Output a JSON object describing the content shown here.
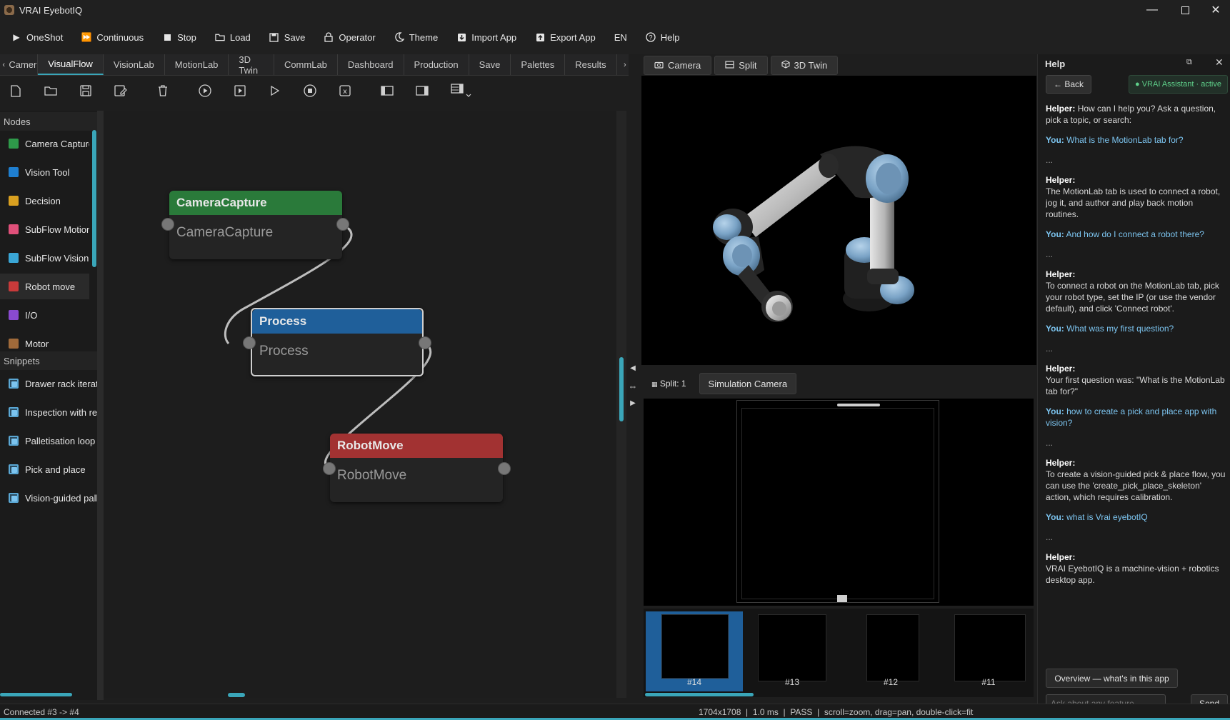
{
  "window": {
    "title": "VRAI EyebotIQ"
  },
  "toolbar": {
    "oneshot": "OneShot",
    "continuous": "Continuous",
    "stop": "Stop",
    "load": "Load",
    "save": "Save",
    "operator": "Operator",
    "theme": "Theme",
    "import_app": "Import App",
    "export_app": "Export App",
    "language": "EN",
    "help": "Help"
  },
  "tabs": [
    "Camera",
    "VisualFlow",
    "VisionLab",
    "MotionLab",
    "3D Twin",
    "CommLab",
    "Dashboard",
    "Production",
    "Save",
    "Palettes",
    "Results"
  ],
  "active_tab": "VisualFlow",
  "sidebar": {
    "nodes_header": "Nodes",
    "nodes": [
      {
        "label": "Camera Capture",
        "color": "#2e9a4a"
      },
      {
        "label": "Vision Tool",
        "color": "#1f7fd0"
      },
      {
        "label": "Decision",
        "color": "#d9a020"
      },
      {
        "label": "SubFlow Motion",
        "color": "#e0507a"
      },
      {
        "label": "SubFlow Vision",
        "color": "#3aa6d6"
      },
      {
        "label": "Robot move",
        "color": "#c83a3a"
      },
      {
        "label": "I/O",
        "color": "#8a4ad0"
      },
      {
        "label": "Motor",
        "color": "#a06a3a"
      }
    ],
    "snippets_header": "Snippets",
    "snippets": [
      "Drawer rack iteratio",
      "Inspection with retr",
      "Palletisation loop",
      "Pick and place",
      "Vision-guided palle"
    ]
  },
  "flow": {
    "nodes": [
      {
        "title": "CameraCapture",
        "body": "CameraCapture",
        "color": "#2a7a3a"
      },
      {
        "title": "Process",
        "body": "Process",
        "color": "#1f5f9a"
      },
      {
        "title": "RobotMove",
        "body": "RobotMove",
        "color": "#a23232"
      }
    ]
  },
  "view_tabs": {
    "camera": "Camera",
    "split": "Split",
    "twin": "3D Twin"
  },
  "split": {
    "label": "Split: 1",
    "camera_name": "Simulation Camera"
  },
  "thumbnails": [
    "#14",
    "#13",
    "#12",
    "#11"
  ],
  "help": {
    "title": "Help",
    "back": "← Back",
    "assistant": "● VRAI Assistant · active",
    "messages": [
      {
        "who": "Helper:",
        "text": "How can I help you? Ask a question, pick a topic, or search:"
      },
      {
        "who": "You:",
        "text": "What is the MotionLab tab for?"
      },
      {
        "who": "Helper:",
        "text": "The MotionLab tab is used to connect a robot, jog it, and author and play back motion routines."
      },
      {
        "who": "You:",
        "text": "And how do I connect a robot there?"
      },
      {
        "who": "Helper:",
        "text": "To connect a robot on the MotionLab tab, pick your robot type, set the IP (or use the vendor default), and click 'Connect robot'."
      },
      {
        "who": "You:",
        "text": "What was my first question?"
      },
      {
        "who": "Helper:",
        "text": "Your first question was: \"What is the MotionLab tab for?\""
      },
      {
        "who": "You:",
        "text": "how to create a pick and place app with vision?"
      },
      {
        "who": "Helper:",
        "text": "To create a vision-guided pick & place flow, you can use the 'create_pick_place_skeleton' action, which requires calibration."
      },
      {
        "who": "You:",
        "text": "what is Vrai eyebotIQ"
      },
      {
        "who": "Helper:",
        "text": "VRAI EyebotIQ is a machine-vision + robotics desktop app."
      }
    ],
    "ellipsis": "...",
    "overview_button": "Overview — what's in this app",
    "input_placeholder": "Ask about any feature...",
    "send": "Send"
  },
  "status": {
    "left": "Connected #3 -> #4",
    "resolution": "1704x1708",
    "time": "1.0 ms",
    "result": "PASS",
    "hint": "scroll=zoom, drag=pan, double-click=fit"
  },
  "colors": {
    "accent": "#3aa6b9",
    "link": "#7cc4ef"
  }
}
